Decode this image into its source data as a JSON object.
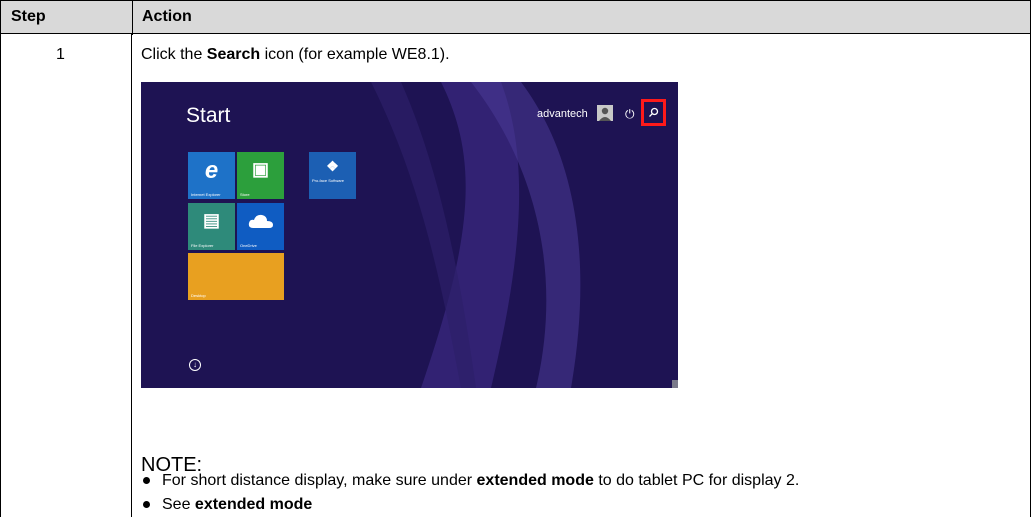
{
  "table": {
    "header": {
      "step": "Step",
      "action": "Action"
    },
    "row": {
      "step": "1",
      "instruction": {
        "pre": "Click the ",
        "bold": "Search",
        "post": " icon (for example WE8.1)."
      }
    }
  },
  "screenshot": {
    "start_label": "Start",
    "username": "advantech",
    "tiles": [
      {
        "label": "Internet Explorer",
        "color": "#1e72c8"
      },
      {
        "label": "Store",
        "color": "#2c9f3c"
      },
      {
        "label": "Pro-face Software",
        "color": "#1c5fb3"
      },
      {
        "label": "File Explorer",
        "color": "#2e8a7a"
      },
      {
        "label": "OneDrive",
        "color": "#0f5cc2"
      },
      {
        "label": "Desktop",
        "color": "#e8a020"
      }
    ],
    "background_color": "#1e1353",
    "highlight_color": "#ff1a1a"
  },
  "note": {
    "title": "NOTE:",
    "bullet1": {
      "pre": "For short distance display, make sure under ",
      "bold": "extended mode",
      "post": " to do tablet PC for display 2."
    },
    "bullet2": {
      "pre": "See ",
      "bold": "extended mode"
    }
  }
}
